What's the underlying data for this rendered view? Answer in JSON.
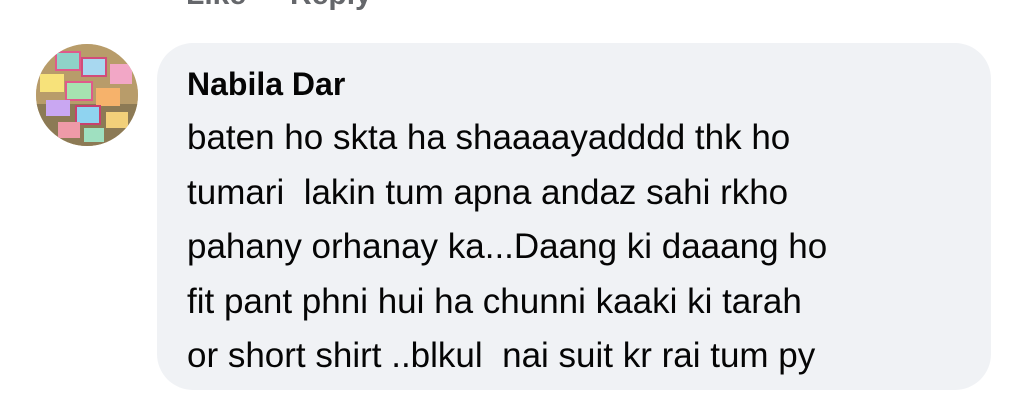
{
  "previous_comment": {
    "actions": [
      "Like",
      "Reply"
    ]
  },
  "comment": {
    "author": "Nabila Dar",
    "lines": [
      "baten ho skta ha shaaaayadddd thk ho",
      "tumari  lakin tum apna andaz sahi rkho",
      "pahany orhanay ka...Daang ki daaang ho",
      "fit pant phni hui ha chunni kaaki ki tarah",
      "or short shirt ..blkul  nai suit kr rai tum py"
    ]
  },
  "colors": {
    "bubble_background": "#f0f2f5",
    "text": "#050505",
    "secondary_text": "#65676b"
  },
  "icons": {
    "avatar": "profile-picture"
  }
}
